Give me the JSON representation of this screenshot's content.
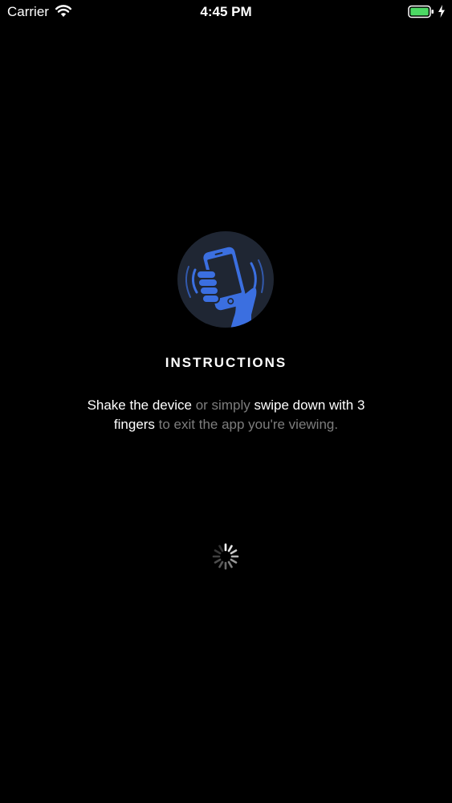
{
  "status_bar": {
    "carrier": "Carrier",
    "time": "4:45 PM",
    "wifi_icon": "wifi-icon",
    "battery_icon": "battery-icon",
    "charging_icon": "bolt-icon"
  },
  "instructions": {
    "icon": "shake-phone-icon",
    "title": "INSTRUCTIONS",
    "desc": {
      "part1": "Shake the device",
      "part2": " or simply ",
      "part3": "swipe down with 3 fingers",
      "part4": " to exit the app you're viewing."
    }
  },
  "loading": {
    "icon": "loading-spinner-icon"
  },
  "colors": {
    "background": "#000000",
    "accent": "#3b6fe0",
    "badge": "#1f2633",
    "muted_text": "#7d7d7d",
    "battery": "#4cd964"
  }
}
